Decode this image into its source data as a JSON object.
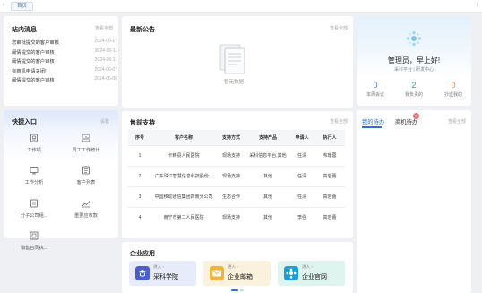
{
  "tabbar": {
    "left_arrow": "‹",
    "right_arrow": "›",
    "active_tab": "首页"
  },
  "messages": {
    "title": "站内消息",
    "more": "查看全部",
    "items": [
      {
        "text": "您审批提交的客户审核",
        "date": "2024-06-17"
      },
      {
        "text": "阚倩提交的客户审核",
        "date": "2024-06-11"
      },
      {
        "text": "阚倩提交的客户审核",
        "date": "2024-06-11"
      },
      {
        "text": "有商机申请关闭!",
        "date": "2024-06-07"
      },
      {
        "text": "阚倩提交的客户审核",
        "date": "2024-06-06"
      }
    ]
  },
  "announcements": {
    "title": "最新公告",
    "more": "查看全部",
    "empty_text": "暂无数据"
  },
  "profile": {
    "greeting": "管理员，早上好!",
    "dept": "采科平台 | 研发中心",
    "stats": [
      {
        "value": "0",
        "label": "本周会议",
        "color": "#4a7bd6"
      },
      {
        "value": "2",
        "label": "我负责的",
        "color": "#2fae7b"
      },
      {
        "value": "0",
        "label": "抄送我的",
        "color": "#e8843c"
      }
    ]
  },
  "quick": {
    "title": "快捷入口",
    "settings": "设置",
    "items": [
      {
        "label": "工作项",
        "icon": "work-item-icon"
      },
      {
        "label": "员工工作统计",
        "icon": "work-stats-icon"
      },
      {
        "label": "工作分析",
        "icon": "work-analysis-icon"
      },
      {
        "label": "客户列表",
        "icon": "customer-list-icon"
      },
      {
        "label": "分子公司组...",
        "icon": "subsidiary-icon"
      },
      {
        "label": "重要应收款",
        "icon": "receivable-icon"
      },
      {
        "label": "销售合同执...",
        "icon": "contract-icon"
      }
    ]
  },
  "support": {
    "title": "售前支持",
    "more": "查看全部",
    "headers": [
      "序号",
      "客户名称",
      "支持方式",
      "支持产品",
      "申请人",
      "执行人"
    ],
    "rows": [
      [
        "1",
        "卡精县人民医院",
        "现场支持",
        "采科信息平台,其他",
        "任清",
        "韦珊蓉"
      ],
      [
        "2",
        "广东珠江智慧信息科技股份...",
        "现场支持",
        "其他",
        "任清",
        "高岩蕾"
      ],
      [
        "3",
        "中国移动通信集团四南分公司",
        "生态合作",
        "其他",
        "任清",
        "高岩蕾"
      ],
      [
        "4",
        "南宁市第二人民医院",
        "现场支持",
        "其他",
        "李强",
        "高岩蕾"
      ]
    ]
  },
  "todo": {
    "tab1": "我的待办",
    "tab2": "商机待办",
    "badge": "8",
    "more": "查看全部"
  },
  "apps": {
    "title": "企业应用",
    "tiles": [
      {
        "sub": "进入 ›",
        "name": "采科学院",
        "bg": "#e8ecfa",
        "logo_color": "#4b5fc8",
        "icon": "academy-icon"
      },
      {
        "sub": "进入 ›",
        "name": "企业邮箱",
        "bg": "#fbf2dd",
        "logo_color": "#f2b33d",
        "icon": "mail-icon"
      },
      {
        "sub": "进入 ›",
        "name": "企业官网",
        "bg": "#dff4ee",
        "logo_color": "#1c9ed8",
        "icon": "website-icon"
      }
    ]
  },
  "colors": {
    "accent": "#2a6fdb",
    "background": "#eef0f4"
  }
}
